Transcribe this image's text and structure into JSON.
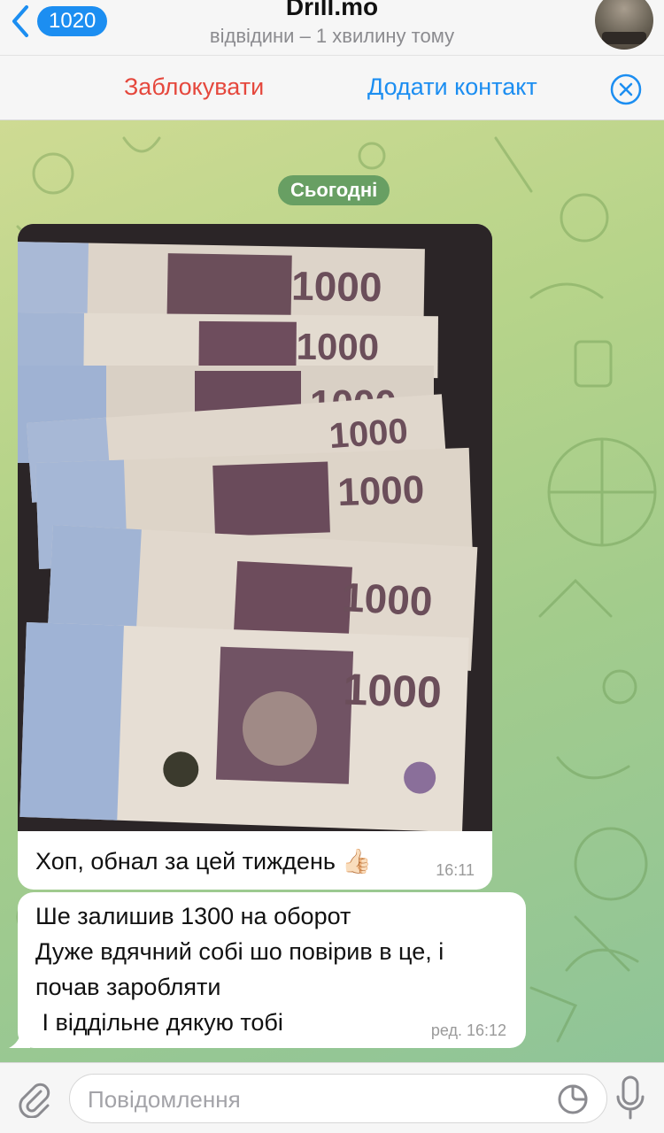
{
  "header": {
    "back_count": "1020",
    "title": "Drill.mo",
    "status": "відвідини – 1 хвилину тому"
  },
  "action_bar": {
    "block_label": "Заблокувати",
    "add_contact_label": "Додати контакт"
  },
  "chat": {
    "date_label": "Сьогодні",
    "messages": [
      {
        "type": "photo",
        "caption": "Хоп, обнал за цей тиждень 👍🏻",
        "time": "16:11"
      },
      {
        "type": "text",
        "lines": [
          "Ше залишив 1300 на оборот",
          "Дуже вдячний собі шо повірив в це, і",
          "почав заробляти",
          " І віддільне дякую тобі"
        ],
        "time": "ред. 16:12"
      }
    ]
  },
  "input": {
    "placeholder": "Повідомлення"
  },
  "colors": {
    "accent": "#1c8ef1",
    "danger": "#e5483d"
  },
  "icons": [
    "chevron-left-icon",
    "close-circle-icon",
    "paperclip-icon",
    "sticker-icon",
    "microphone-icon"
  ]
}
